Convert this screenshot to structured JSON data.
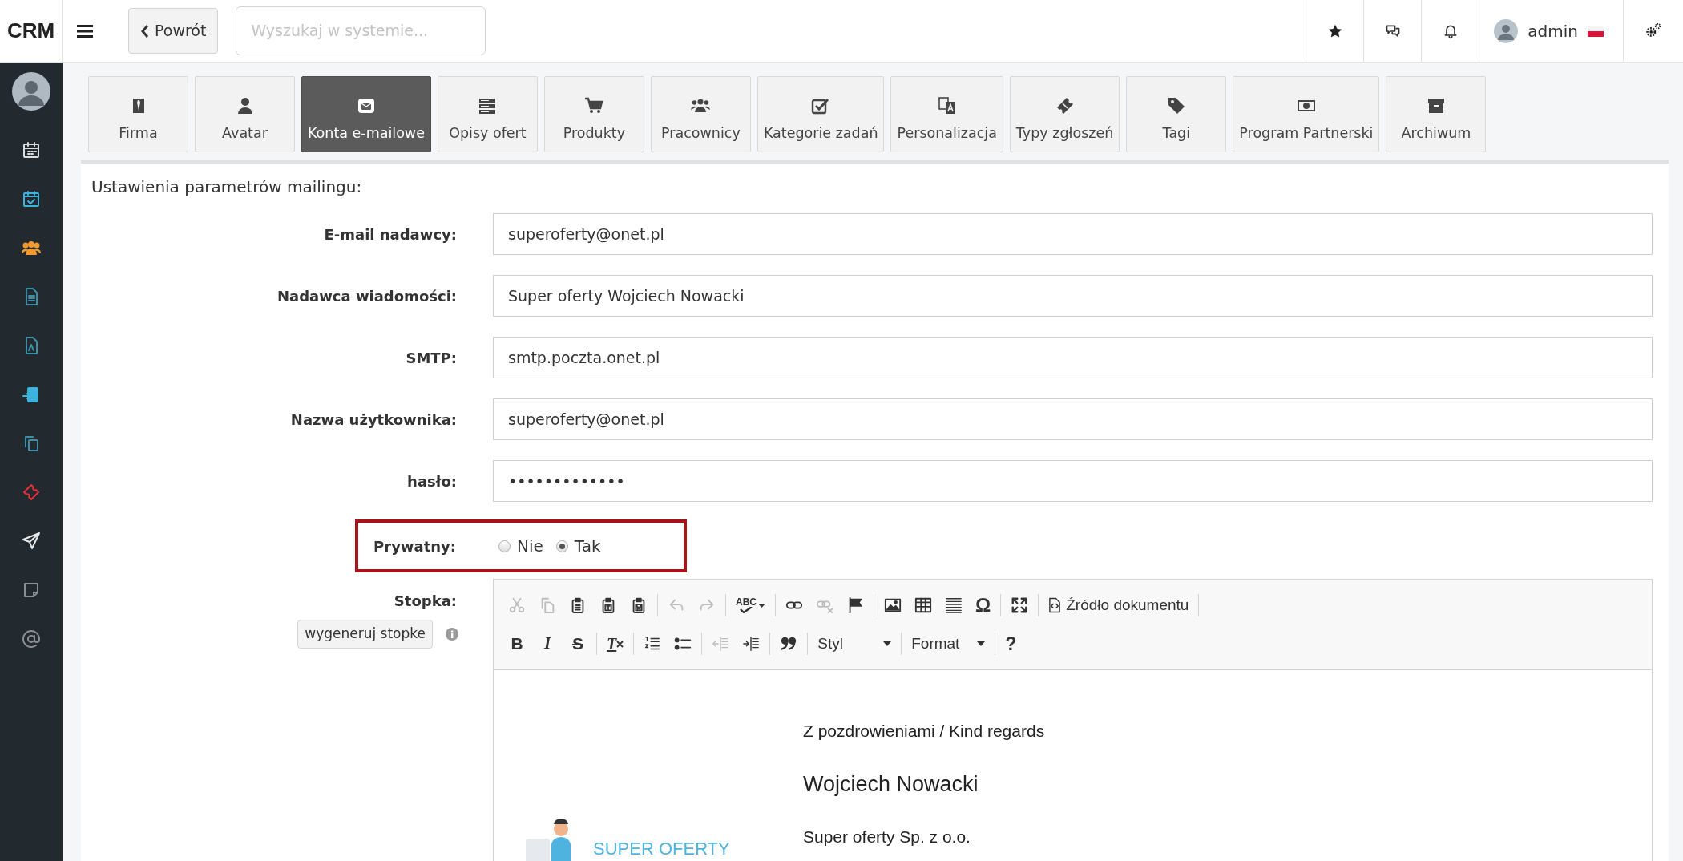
{
  "topbar": {
    "logo": "CRM",
    "back_button": "Powrót",
    "search": {
      "placeholder": "Wyszukaj w systemie..."
    },
    "user": {
      "name": "admin"
    }
  },
  "tabs": [
    {
      "label": "Firma",
      "selected": false
    },
    {
      "label": "Avatar",
      "selected": false
    },
    {
      "label": "Konta e-mailowe",
      "selected": true
    },
    {
      "label": "Opisy ofert",
      "selected": false
    },
    {
      "label": "Produkty",
      "selected": false
    },
    {
      "label": "Pracownicy",
      "selected": false
    },
    {
      "label": "Kategorie zadań",
      "selected": false
    },
    {
      "label": "Personalizacja",
      "selected": false
    },
    {
      "label": "Typy zgłoszeń",
      "selected": false
    },
    {
      "label": "Tagi",
      "selected": false
    },
    {
      "label": "Program Partnerski",
      "selected": false
    },
    {
      "label": "Archiwum",
      "selected": false
    }
  ],
  "section_title": "Ustawienia parametrów mailingu:",
  "fields": [
    {
      "label": "E-mail nadawcy:",
      "value": "superoferty@onet.pl"
    },
    {
      "label": "Nadawca wiadomości:",
      "value": "Super oferty Wojciech Nowacki"
    },
    {
      "label": "SMTP:",
      "value": "smtp.poczta.onet.pl"
    },
    {
      "label": "Nazwa użytkownika:",
      "value": "superoferty@onet.pl"
    },
    {
      "label": "hasło:",
      "value": "•••••••••••••"
    }
  ],
  "private": {
    "label": "Prywatny:",
    "highlighted": true,
    "options": [
      {
        "label": "Nie",
        "selected": false
      },
      {
        "label": "Tak",
        "selected": true
      }
    ]
  },
  "footer": {
    "label": "Stopka:",
    "generate_button": "wygeneruj stopke",
    "toolbar": [
      [
        {
          "kind": "cut",
          "disabled": true
        },
        {
          "kind": "copy",
          "disabled": true
        },
        {
          "kind": "paste",
          "disabled": false
        },
        {
          "kind": "paste_text",
          "disabled": false
        },
        {
          "kind": "paste_word",
          "disabled": false
        },
        {
          "kind": "separator"
        },
        {
          "kind": "undo",
          "disabled": true
        },
        {
          "kind": "redo",
          "disabled": true
        },
        {
          "kind": "separator"
        },
        {
          "kind": "spellcheck",
          "label": "ABC",
          "disabled": false
        },
        {
          "kind": "separator"
        },
        {
          "kind": "link",
          "disabled": false
        },
        {
          "kind": "unlink",
          "disabled": true
        },
        {
          "kind": "anchor",
          "disabled": false
        },
        {
          "kind": "separator"
        },
        {
          "kind": "image",
          "disabled": false
        },
        {
          "kind": "table",
          "disabled": false
        },
        {
          "kind": "hr",
          "disabled": false
        },
        {
          "kind": "glyph",
          "label": "Ω",
          "disabled": false
        },
        {
          "kind": "separator"
        },
        {
          "kind": "maximize",
          "disabled": false
        },
        {
          "kind": "separator"
        },
        {
          "kind": "source",
          "label": "Źródło dokumentu",
          "disabled": false
        },
        {
          "kind": "separator"
        }
      ],
      [
        {
          "kind": "bold",
          "label": "B",
          "disabled": false
        },
        {
          "kind": "italic",
          "label": "I",
          "disabled": false
        },
        {
          "kind": "strike",
          "label": "S",
          "disabled": false
        },
        {
          "kind": "separator"
        },
        {
          "kind": "removeformat",
          "label": "T",
          "disabled": false
        },
        {
          "kind": "separator"
        },
        {
          "kind": "numbered",
          "disabled": false
        },
        {
          "kind": "bulleted",
          "disabled": false
        },
        {
          "kind": "separator"
        },
        {
          "kind": "outdent",
          "disabled": true
        },
        {
          "kind": "indent",
          "disabled": false
        },
        {
          "kind": "separator"
        },
        {
          "kind": "quote",
          "disabled": false
        },
        {
          "kind": "separator"
        },
        {
          "kind": "dropdown",
          "label": "Styl"
        },
        {
          "kind": "separator"
        },
        {
          "kind": "dropdown",
          "label": "Format"
        },
        {
          "kind": "separator"
        },
        {
          "kind": "help",
          "label": "?",
          "disabled": false
        }
      ]
    ],
    "content": {
      "logo_text": "SUPER OFERTY",
      "lines": [
        {
          "kind": "text",
          "text": "Z pozdrowieniami / Kind regards"
        },
        {
          "kind": "heading",
          "text": "Wojciech Nowacki"
        },
        {
          "kind": "text",
          "text": "Super oferty Sp. z o.o."
        }
      ]
    }
  }
}
